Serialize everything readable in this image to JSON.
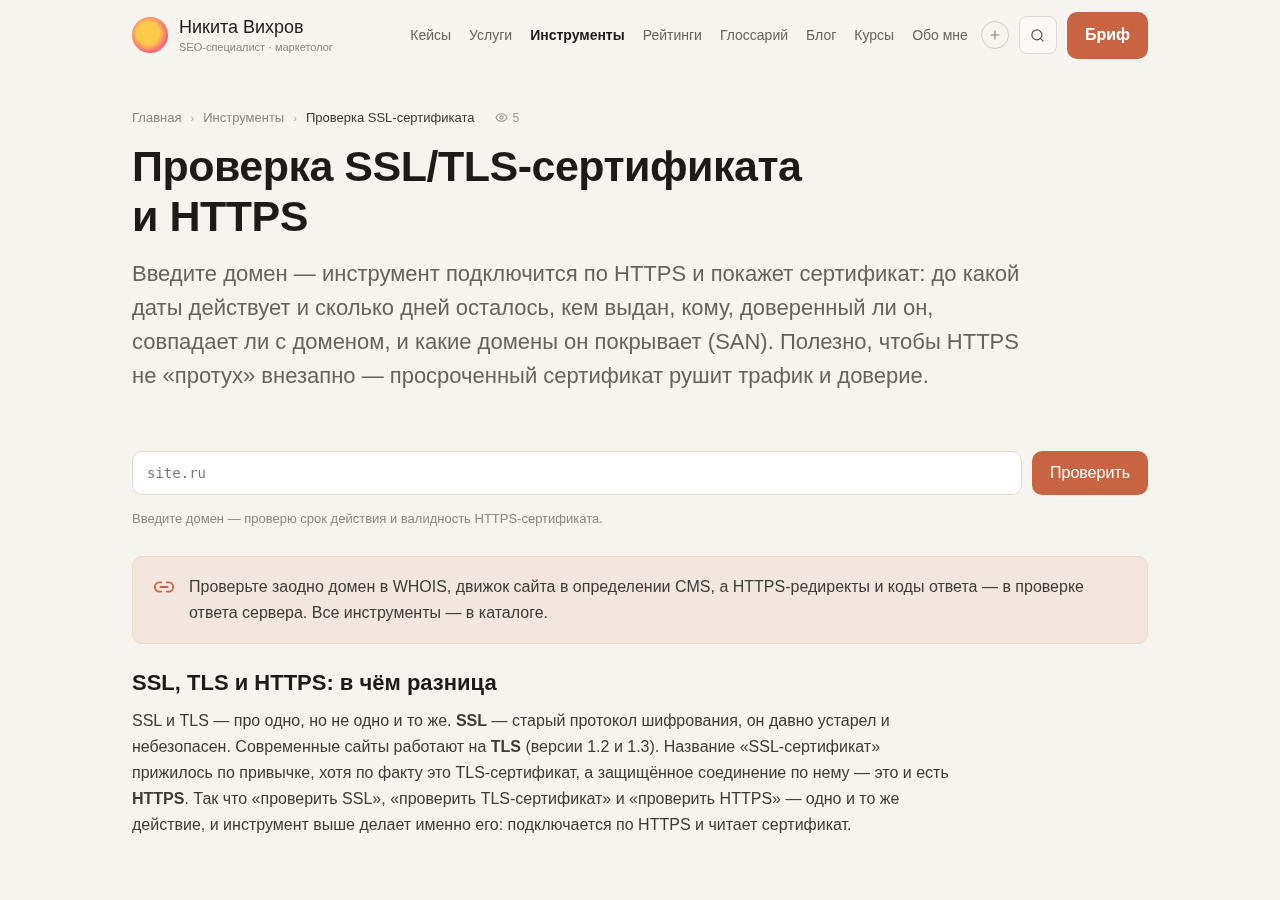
{
  "header": {
    "name": "Никита Вихров",
    "tagline": "SEO-специалист · маркетолог",
    "nav": [
      {
        "label": "Кейсы",
        "selected": false
      },
      {
        "label": "Услуги",
        "selected": false
      },
      {
        "label": "Инструменты",
        "selected": true
      },
      {
        "label": "Рейтинги",
        "selected": false
      },
      {
        "label": "Глоссарий",
        "selected": false
      },
      {
        "label": "Блог",
        "selected": false
      },
      {
        "label": "Курсы",
        "selected": false
      },
      {
        "label": "Обо мне",
        "selected": false
      }
    ],
    "cta": "Бриф"
  },
  "breadcrumbs": [
    {
      "label": "Главная",
      "current": false
    },
    {
      "label": "Инструменты",
      "current": false
    },
    {
      "label": "Проверка SSL-сертификата",
      "current": true
    }
  ],
  "breadcrumb_separator": "›",
  "views": "5",
  "title": "Проверка SSL/TLS-сертификата и HTTPS",
  "lead": "Введите домен — инструмент подключится по HTTPS и покажет сертификат: до какой даты действует и сколько дней осталось, кем выдан, кому, доверенный ли он, совпадает ли с доменом, и какие домены он покрывает (SAN). Полезно, чтобы HTTPS не «протух» внезапно — просроченный сертификат рушит трафик и доверие.",
  "form": {
    "placeholder": "site.ru",
    "button": "Проверить",
    "hint": "Введите домен — проверю срок действия и валидность HTTPS-сертификата."
  },
  "callout": "Проверьте заодно домен в WHOIS, движок сайта в определении CMS, а HTTPS-редиректы и коды ответа — в проверке ответа сервера. Все инструменты — в каталоге.",
  "section": {
    "heading": "SSL, TLS и HTTPS: в чём разница",
    "text": "SSL и TLS — про одно, но не одно и то же. **SSL** — старый протокол шифрования, он давно устарел и небезопасен. Современные сайты работают на **TLS** (версии 1.2 и 1.3). Название «SSL-сертификат» прижилось по привычке, хотя по факту это TLS-сертификат, а защищённое соединение по нему — это и есть **HTTPS**. Так что «проверить SSL», «проверить TLS-сертификат» и «проверить HTTPS» — одно и то же действие, и инструмент выше делает именно его: подключается по HTTPS и читает сертификат."
  }
}
